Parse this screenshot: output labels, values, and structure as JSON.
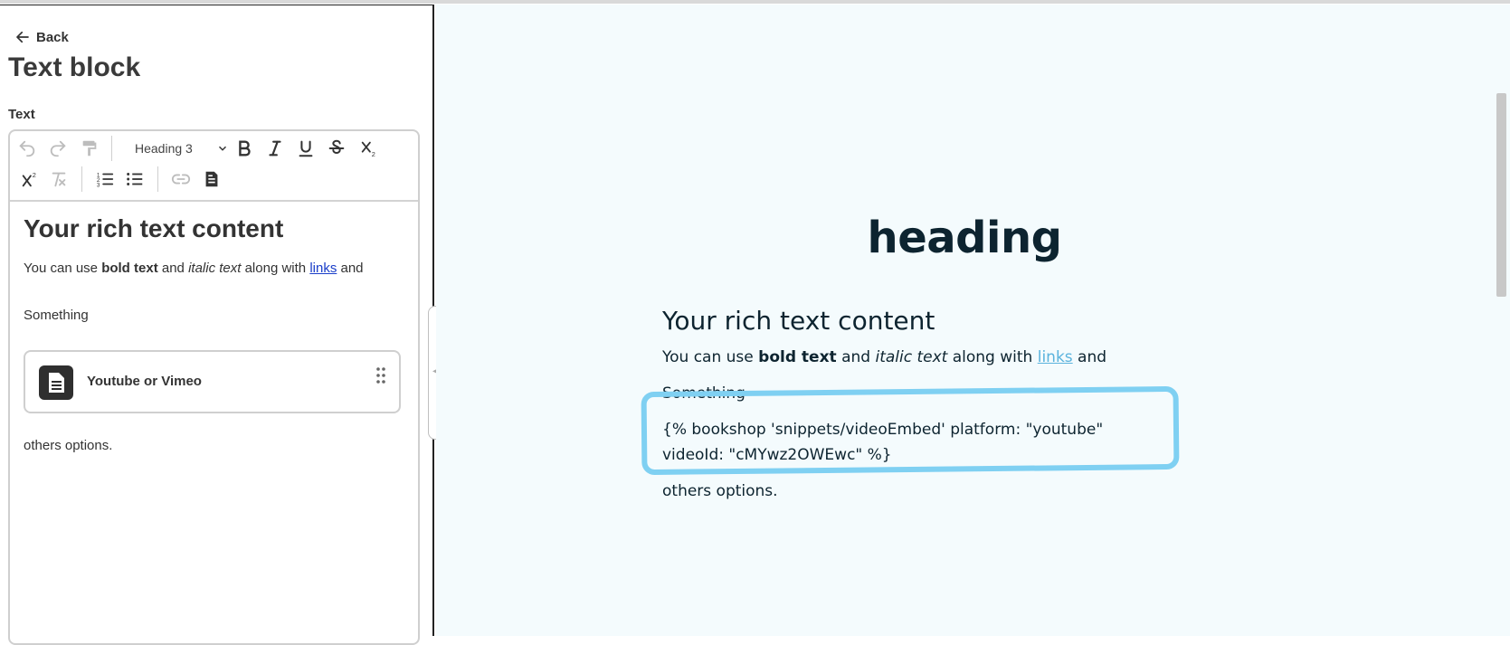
{
  "editor": {
    "back_label": "Back",
    "title": "Text block",
    "field_label": "Text",
    "toolbar": {
      "block_format": "Heading 3",
      "buttons": [
        "undo-icon",
        "redo-icon",
        "format-painter-icon",
        "bold-icon",
        "italic-icon",
        "underline-icon",
        "strikethrough-icon",
        "subscript-icon",
        "superscript-icon",
        "clear-formatting-icon",
        "ordered-list-icon",
        "bulleted-list-icon",
        "link-icon",
        "snippet-icon"
      ]
    },
    "content": {
      "heading": "Your rich text content",
      "p1_before": "You can use ",
      "p1_bold": "bold text",
      "p1_mid": " and ",
      "p1_italic": "italic text",
      "p1_after": " along with ",
      "p1_link": "links",
      "p1_end": " and",
      "p2": "Something",
      "embed_label": "Youtube or Vimeo",
      "p3": "others options."
    }
  },
  "preview": {
    "heading": "heading",
    "h3": "Your rich text content",
    "p1_before": "You can use ",
    "p1_bold": "bold text",
    "p1_mid": " and ",
    "p1_italic": "italic text",
    "p1_after": " along with ",
    "p1_link": "links",
    "p1_end": " and",
    "p2": "Something",
    "code": "{% bookshop 'snippets/videoEmbed' platform: \"youtube\" videoId: \"cMYwz2OWEwc\" %}",
    "p4": "others options.",
    "annotation_color": "#7fd0f2"
  },
  "colors": {
    "preview_bg": "#f4fbfd",
    "link_editor": "#1a3ec9",
    "link_preview": "#5ab3dd",
    "text_dark": "#0d2430"
  }
}
